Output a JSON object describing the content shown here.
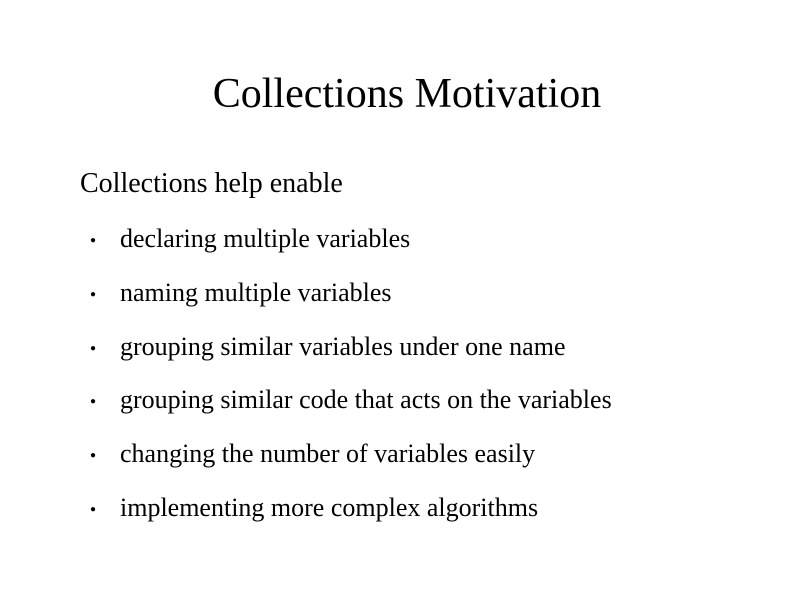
{
  "title": "Collections Motivation",
  "subtitle": "Collections help enable",
  "bullets": [
    "declaring multiple variables",
    "naming multiple variables",
    "grouping similar variables under one name",
    "grouping similar code that acts on the variables",
    "changing the number of variables easily",
    "implementing more complex algorithms"
  ]
}
